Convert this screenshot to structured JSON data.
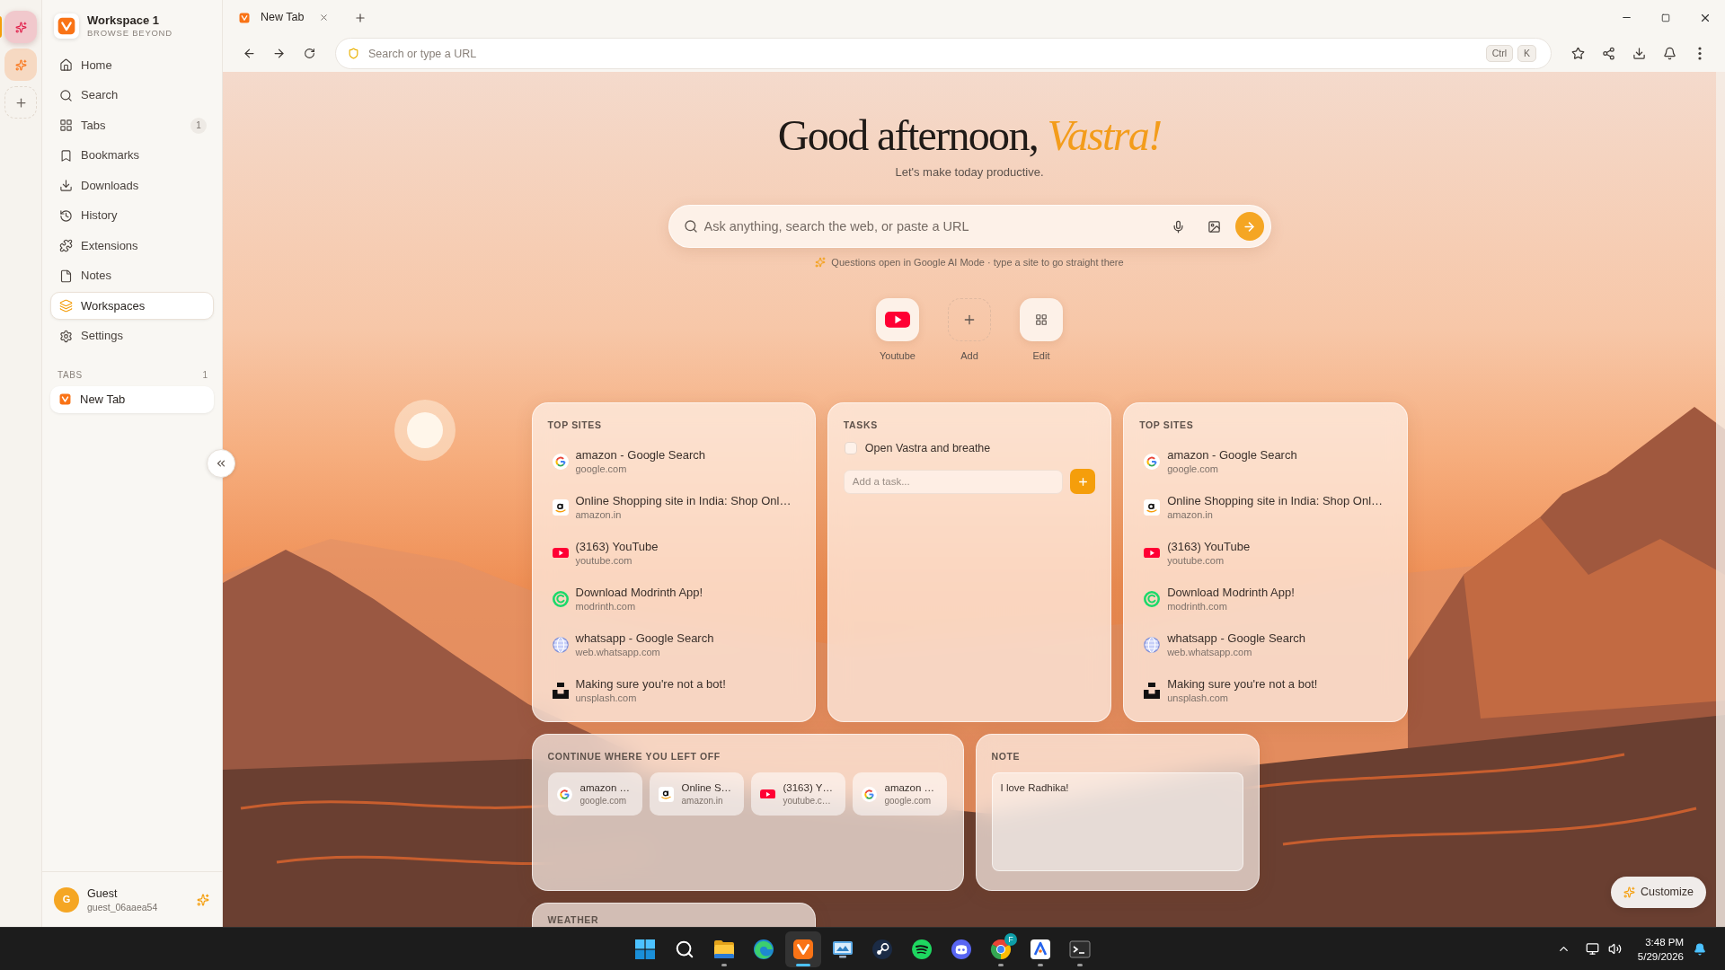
{
  "rail": {
    "workspaces": [
      {
        "selected": true,
        "color": "#e11d48"
      },
      {
        "selected": false,
        "color": "#f97316"
      }
    ]
  },
  "sidebar": {
    "title": "Workspace 1",
    "tagline": "BROWSE BEYOND",
    "nav": [
      {
        "label": "Home",
        "selected": false
      },
      {
        "label": "Search",
        "selected": false
      },
      {
        "label": "Tabs",
        "badge": "1",
        "selected": false
      },
      {
        "label": "Bookmarks",
        "selected": false
      },
      {
        "label": "Downloads",
        "selected": false
      },
      {
        "label": "History",
        "selected": false
      },
      {
        "label": "Extensions",
        "selected": false
      },
      {
        "label": "Notes",
        "selected": false
      },
      {
        "label": "Workspaces",
        "selected": true
      },
      {
        "label": "Settings",
        "selected": false
      }
    ],
    "tabs_section": {
      "title": "TABS",
      "count": "1",
      "tabs": [
        {
          "title": "New Tab",
          "selected": true
        }
      ]
    },
    "user": {
      "initial": "G",
      "name": "Guest",
      "handle": "guest_06aaea54"
    }
  },
  "tab_strip": {
    "tabs": [
      {
        "title": "New Tab",
        "selected": true
      }
    ]
  },
  "toolbar": {
    "address_placeholder": "Search or type a URL",
    "shortcut_keys": [
      "Ctrl",
      "K"
    ]
  },
  "new_tab": {
    "greeting": "Good afternoon, *Vastra!*",
    "subtitle": "Let's make today productive.",
    "search_placeholder": "Ask anything, search the web, or paste a URL",
    "hint": "Questions open in Google AI Mode · type a site to go straight there",
    "shortcuts": [
      {
        "kind": "youtube",
        "label": "Youtube"
      },
      {
        "kind": "add",
        "label": "Add"
      },
      {
        "kind": "edit",
        "label": "Edit"
      }
    ],
    "widgets": [
      {
        "kind": "top_sites",
        "title": "TOP SITES",
        "sites": [
          {
            "kind": "google",
            "title": "amazon - Google Search",
            "domain": "google.com"
          },
          {
            "kind": "amazon",
            "title": "Online Shopping site in India: Shop Onl…",
            "domain": "amazon.in"
          },
          {
            "kind": "youtube",
            "title": "(3163) YouTube",
            "domain": "youtube.com"
          },
          {
            "kind": "modrinth",
            "title": "Download Modrinth App!",
            "domain": "modrinth.com"
          },
          {
            "kind": "globe",
            "title": "whatsapp - Google Search",
            "domain": "web.whatsapp.com"
          },
          {
            "kind": "unsplash",
            "title": "Making sure you're not a bot!",
            "domain": "unsplash.com"
          }
        ]
      },
      {
        "kind": "tasks",
        "title": "TASKS",
        "tasks": [
          {
            "text": "Open Vastra and breathe",
            "checked": false
          }
        ],
        "input_placeholder": "Add a task..."
      },
      {
        "kind": "top_sites",
        "title": "TOP SITES",
        "sites": [
          {
            "kind": "google",
            "title": "amazon - Google Search",
            "domain": "google.com"
          },
          {
            "kind": "amazon",
            "title": "Online Shopping site in India: Shop Onl…",
            "domain": "amazon.in"
          },
          {
            "kind": "youtube",
            "title": "(3163) YouTube",
            "domain": "youtube.com"
          },
          {
            "kind": "modrinth",
            "title": "Download Modrinth App!",
            "domain": "modrinth.com"
          },
          {
            "kind": "globe",
            "title": "whatsapp - Google Search",
            "domain": "web.whatsapp.com"
          },
          {
            "kind": "unsplash",
            "title": "Making sure you're not a bot!",
            "domain": "unsplash.com"
          }
        ]
      },
      {
        "kind": "continue",
        "title": "CONTINUE WHERE YOU LEFT OFF",
        "items": [
          {
            "kind": "google",
            "title": "amazon …",
            "domain": "google.com"
          },
          {
            "kind": "amazon",
            "title": "Online S…",
            "domain": "amazon.in"
          },
          {
            "kind": "youtube",
            "title": "(3163) Y…",
            "domain": "youtube.c…"
          },
          {
            "kind": "google",
            "title": "amazon …",
            "domain": "google.com"
          }
        ]
      },
      {
        "kind": "note",
        "title": "NOTE",
        "text": "I love Radhika!"
      },
      {
        "kind": "weather",
        "title": "WEATHER"
      }
    ],
    "customize_button": "Customize"
  },
  "taskbar": {
    "apps": [
      {
        "kind": "start",
        "running": false,
        "selected": false
      },
      {
        "kind": "search",
        "running": false,
        "selected": false
      },
      {
        "kind": "folder",
        "running": true,
        "selected": false
      },
      {
        "kind": "edge",
        "running": false,
        "selected": false
      },
      {
        "kind": "vastra",
        "running": true,
        "selected": true
      },
      {
        "kind": "screen",
        "running": false,
        "selected": false
      },
      {
        "kind": "steam",
        "running": false,
        "selected": false
      },
      {
        "kind": "spotify",
        "running": false,
        "selected": false
      },
      {
        "kind": "discord",
        "running": false,
        "selected": false
      },
      {
        "kind": "chrome",
        "running": true,
        "selected": false,
        "badge": "F"
      },
      {
        "kind": "triangle",
        "running": true,
        "selected": false
      },
      {
        "kind": "terminal",
        "running": true,
        "selected": false
      }
    ],
    "clock": {
      "time": "3:48 PM",
      "date": "5/29/2026"
    }
  }
}
